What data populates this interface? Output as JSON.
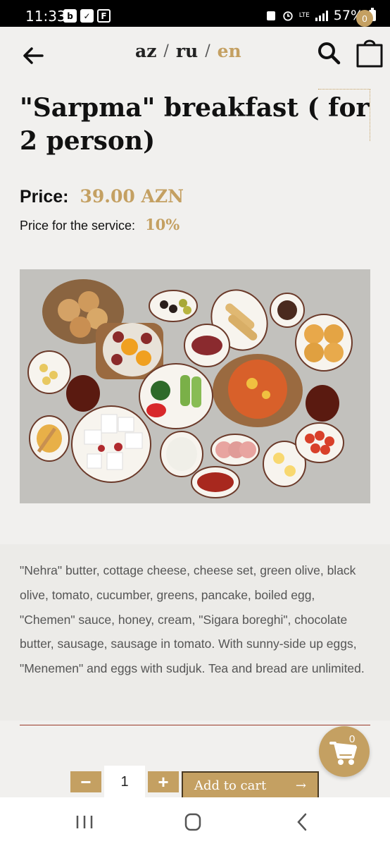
{
  "status_bar": {
    "time": "11:33",
    "apps": [
      "b",
      "✓",
      "F"
    ],
    "network": "LTE",
    "battery": "57%"
  },
  "header": {
    "languages": [
      {
        "code": "az",
        "active": false
      },
      {
        "code": "ru",
        "active": false
      },
      {
        "code": "en",
        "active": true
      }
    ],
    "separator": "/",
    "cart_count": "0"
  },
  "product": {
    "title": "\"Sarpma\" breakfast ( for 2 person)",
    "price_label": "Price:",
    "price_value": "39.00 AZN",
    "service_label": "Price for the service:",
    "service_value": "10%",
    "description": "\"Nehra\" butter, cottage cheese, cheese set, green olive, black olive, tomato, cucumber, greens, pancake, boiled egg, \"Chemen\" sauce, honey, cream, \"Sigara boreghi\", chocolate butter, sausage, sausage in tomato. With sunny-side up eggs, \"Menemen\" and eggs with sudjuk. Tea and bread are unlimited."
  },
  "purchase": {
    "minus": "−",
    "plus": "+",
    "quantity": "1",
    "add_to_cart": "Add to cart",
    "arrow": "→"
  },
  "floating_cart": {
    "count": "0"
  },
  "colors": {
    "accent": "#c4a062",
    "background": "#f1f0ee",
    "divider": "#9a3a2a"
  },
  "icons": [
    "back-arrow-icon",
    "search-icon",
    "shopping-bag-icon",
    "cart-icon",
    "recent-apps-icon",
    "home-icon",
    "nav-back-icon"
  ]
}
